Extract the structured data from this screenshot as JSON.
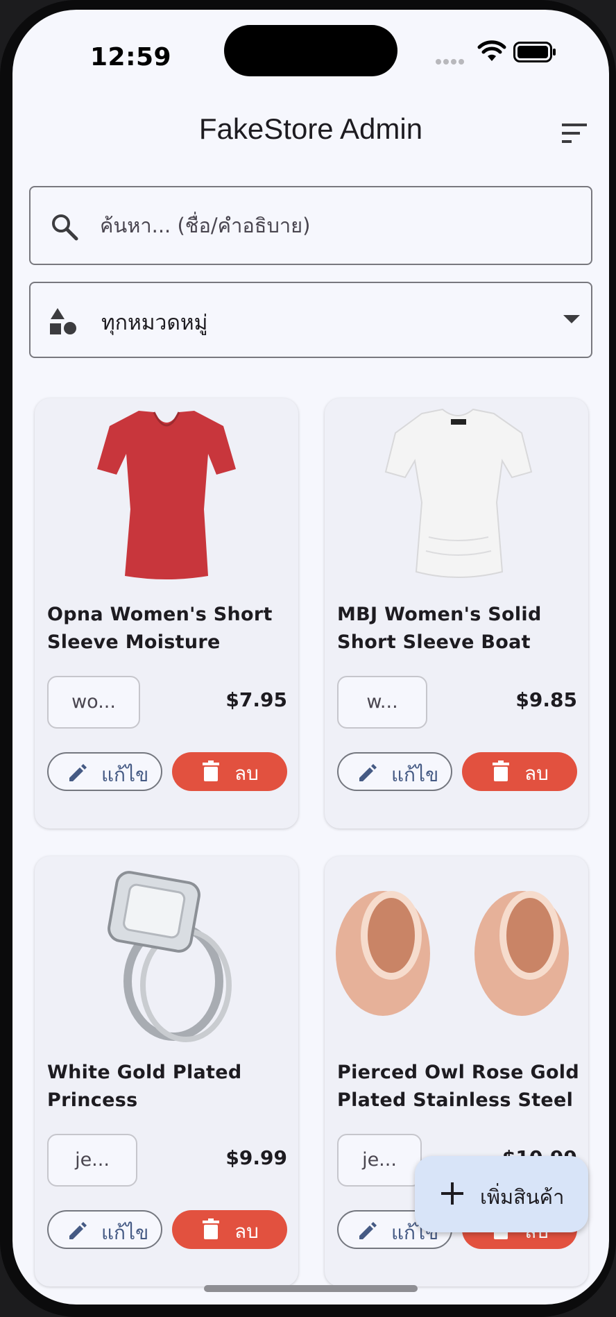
{
  "status_bar": {
    "time": "12:59"
  },
  "app_bar": {
    "title": "FakeStore Admin",
    "sort_icon": "sort-icon"
  },
  "search": {
    "placeholder": "ค้นหา... (ชื่อ/คำอธิบาย)",
    "value": ""
  },
  "category_filter": {
    "selected": "ทุกหมวดหมู่",
    "icon": "category-icon"
  },
  "products": [
    {
      "title": "Opna Women's Short Sleeve Moisture",
      "category": "wo...",
      "price": "$7.95",
      "image": "red-tshirt"
    },
    {
      "title": "MBJ Women's Solid Short Sleeve Boat Nec...",
      "category": "w...",
      "price": "$9.85",
      "image": "white-top"
    },
    {
      "title": "White Gold Plated Princess",
      "category": "je...",
      "price": "$9.99",
      "image": "diamond-ring"
    },
    {
      "title": "Pierced Owl Rose Gold Plated Stainless Steel ...",
      "category": "je...",
      "price": "$10.99",
      "image": "rose-gold-plugs"
    }
  ],
  "actions": {
    "edit_label": "แก้ไข",
    "delete_label": "ลบ"
  },
  "fab": {
    "label": "เพิ่มสินค้า"
  },
  "colors": {
    "delete": "#e2513f",
    "edit_text": "#455a84",
    "fab_bg": "#d8e4f8",
    "background": "#f6f7fd"
  }
}
